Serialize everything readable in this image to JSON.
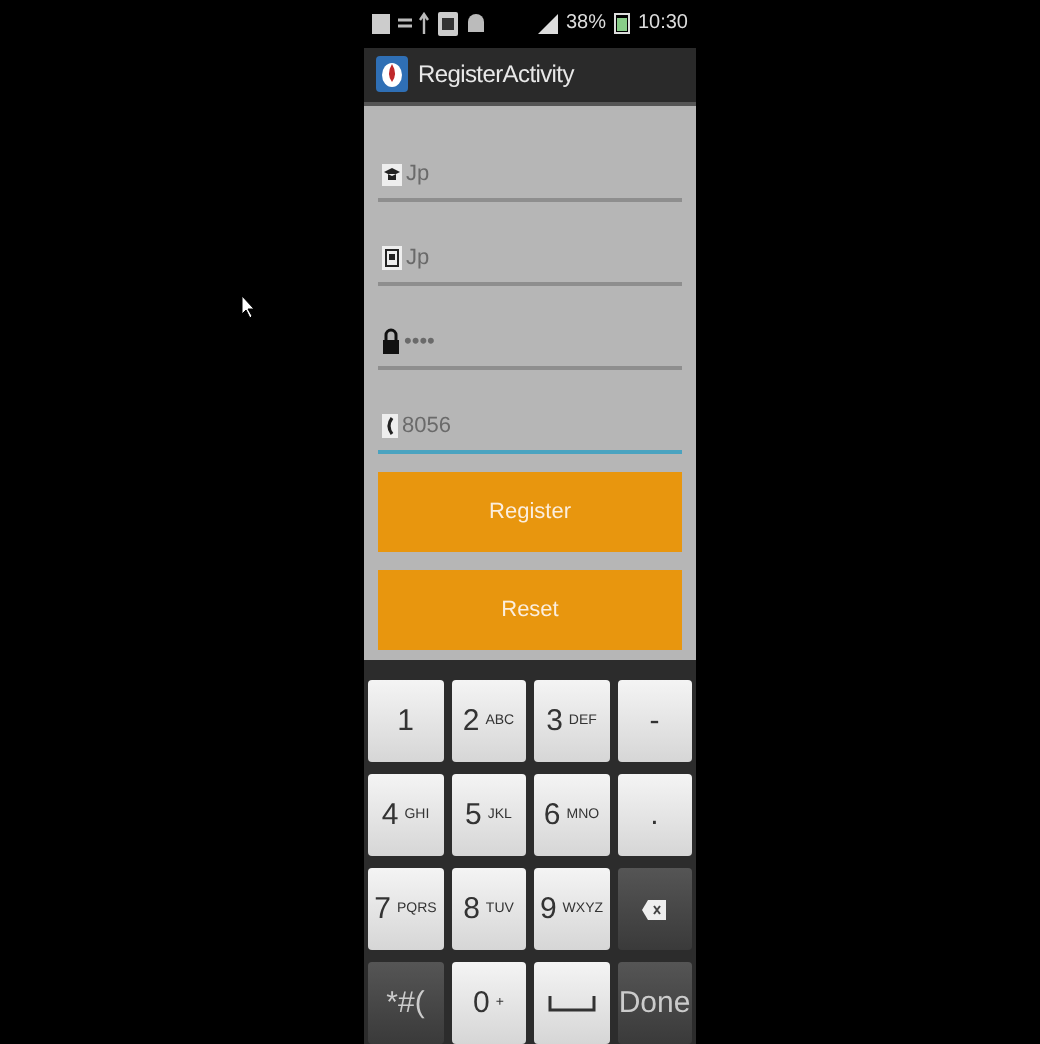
{
  "status_bar": {
    "battery": "38%",
    "time": "10:30"
  },
  "action_bar": {
    "title": "RegisterActivity"
  },
  "fields": [
    {
      "kind": "user",
      "placeholder": "Jp",
      "focused": false
    },
    {
      "kind": "id",
      "placeholder": "Jp",
      "focused": false
    },
    {
      "kind": "password",
      "placeholder": "••••",
      "focused": false
    },
    {
      "kind": "phone",
      "placeholder": "8056",
      "focused": true
    }
  ],
  "buttons": [
    {
      "label": "Register"
    },
    {
      "label": "Reset"
    }
  ],
  "keyboard": [
    [
      {
        "kind": "light",
        "main": "1"
      },
      {
        "kind": "light",
        "main": "2",
        "sub": "ABC"
      },
      {
        "kind": "light",
        "main": "3",
        "sub": "DEF"
      },
      {
        "kind": "light",
        "main": "-"
      }
    ],
    [
      {
        "kind": "light",
        "main": "4",
        "sub": "GHI"
      },
      {
        "kind": "light",
        "main": "5",
        "sub": "JKL"
      },
      {
        "kind": "light",
        "main": "6",
        "sub": "MNO"
      },
      {
        "kind": "light",
        "main": "."
      }
    ],
    [
      {
        "kind": "light",
        "main": "7",
        "sub": "PQRS"
      },
      {
        "kind": "light",
        "main": "8",
        "sub": "TUV"
      },
      {
        "kind": "light",
        "main": "9",
        "sub": "WXYZ"
      },
      {
        "kind": "backspace"
      }
    ],
    [
      {
        "kind": "dark",
        "main": "*#("
      },
      {
        "kind": "light",
        "main": "0",
        "sub": "+"
      },
      {
        "kind": "space"
      },
      {
        "kind": "dark",
        "main": "Done"
      }
    ]
  ]
}
